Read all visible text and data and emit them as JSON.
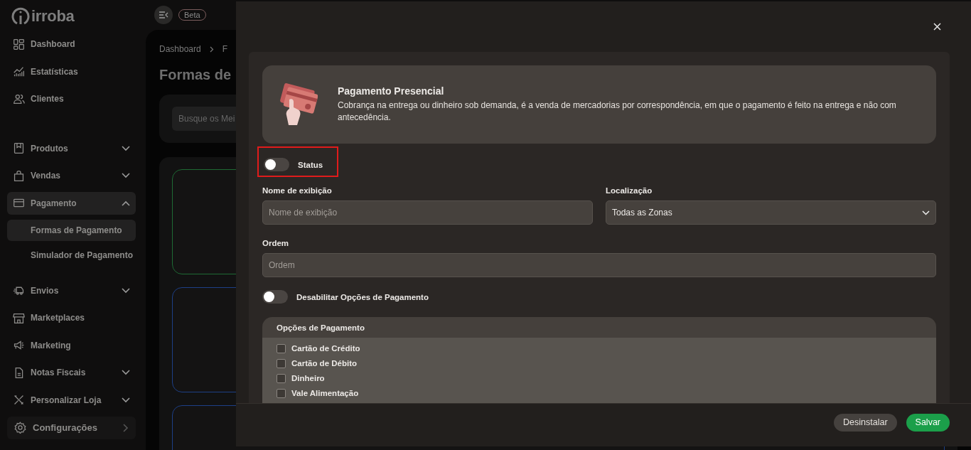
{
  "brand": {
    "logo_text": "irroba"
  },
  "topbar": {
    "badge": "Beta"
  },
  "sidebar": {
    "groups": [
      [
        {
          "label": "Dashboard",
          "kind": "link",
          "selected": false
        },
        {
          "label": "Estatísticas",
          "kind": "link",
          "selected": false
        },
        {
          "label": "Clientes",
          "kind": "link",
          "selected": false
        }
      ],
      [
        {
          "label": "Produtos",
          "kind": "group",
          "expanded": false,
          "selected": false
        },
        {
          "label": "Vendas",
          "kind": "group",
          "expanded": false,
          "selected": false
        },
        {
          "label": "Pagamento",
          "kind": "group",
          "expanded": true,
          "selected": true,
          "children": [
            {
              "label": "Formas de Pagamento",
              "selected": true
            },
            {
              "label": "Simulador de Pagamento",
              "selected": false
            }
          ]
        },
        {
          "label": "Envios",
          "kind": "group",
          "expanded": false,
          "selected": false
        },
        {
          "label": "Marketplaces",
          "kind": "link",
          "selected": false
        },
        {
          "label": "Marketing",
          "kind": "link",
          "selected": false
        },
        {
          "label": "Notas Fiscais",
          "kind": "group",
          "expanded": false,
          "selected": false
        },
        {
          "label": "Personalizar Loja",
          "kind": "group",
          "expanded": false,
          "selected": false
        }
      ]
    ],
    "settings": {
      "label": "Configurações"
    }
  },
  "page": {
    "breadcrumb": [
      "Dashboard",
      "F"
    ],
    "title": "Formas de",
    "search": {
      "placeholder": "Busque os Mei"
    },
    "cards": [
      {
        "color": "#1e6a34"
      },
      {
        "color": "#1d3f86"
      },
      {
        "color": "#1d3f86"
      }
    ]
  },
  "modal": {
    "intro": {
      "title": "Pagamento Presencial",
      "description": "Cobrança na entrega ou dinheiro sob demanda, é a venda de mercadorias por correspondência, em que o pagamento é feito na entrega e não com antecedência."
    },
    "status": {
      "label": "Status",
      "on": false,
      "highlighted": true
    },
    "fields": [
      {
        "label": "Nome de exibição",
        "kind": "text",
        "placeholder": "Nome de exibição"
      },
      {
        "label": "Localização",
        "kind": "select",
        "value": "Todas as Zonas"
      },
      {
        "label": "Ordem",
        "kind": "text",
        "placeholder": "Ordem"
      }
    ],
    "disable_toggle": {
      "label": "Desabilitar Opções de Pagamento",
      "on": false
    },
    "options": {
      "title": "Opções de Pagamento",
      "items": [
        {
          "label": "Cartão de Crédito",
          "checked": false
        },
        {
          "label": "Cartão de Débito",
          "checked": false
        },
        {
          "label": "Dinheiro",
          "checked": false
        },
        {
          "label": "Vale Alimentação",
          "checked": false
        }
      ]
    },
    "buttons": [
      {
        "label": "Desinstalar",
        "kind": "secondary"
      },
      {
        "label": "Salvar",
        "kind": "primary"
      }
    ]
  }
}
